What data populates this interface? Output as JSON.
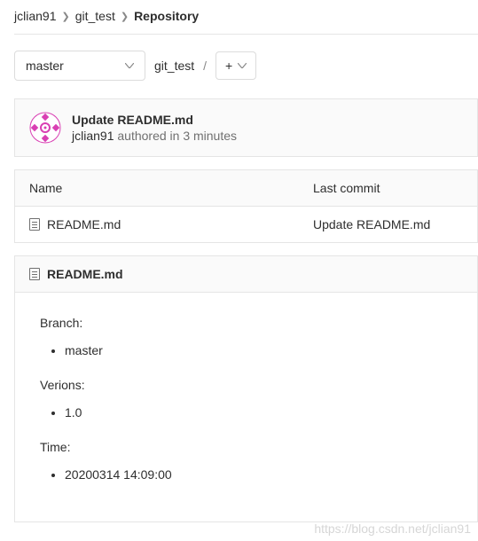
{
  "breadcrumb": {
    "owner": "jclian91",
    "repo": "git_test",
    "current": "Repository"
  },
  "controls": {
    "branch": "master",
    "path_segment": "git_test"
  },
  "commit": {
    "title": "Update README.md",
    "author": "jclian91",
    "authored_text": "authored in 3 minutes"
  },
  "table": {
    "headers": {
      "name": "Name",
      "last_commit": "Last commit"
    },
    "rows": [
      {
        "name": "README.md",
        "last_commit": "Update README.md"
      }
    ]
  },
  "readme": {
    "filename": "README.md",
    "sections": [
      {
        "label": "Branch:",
        "value": "master"
      },
      {
        "label": "Verions:",
        "value": "1.0"
      },
      {
        "label": "Time:",
        "value": "20200314 14:09:00"
      }
    ]
  },
  "watermark": "https://blog.csdn.net/jclian91"
}
